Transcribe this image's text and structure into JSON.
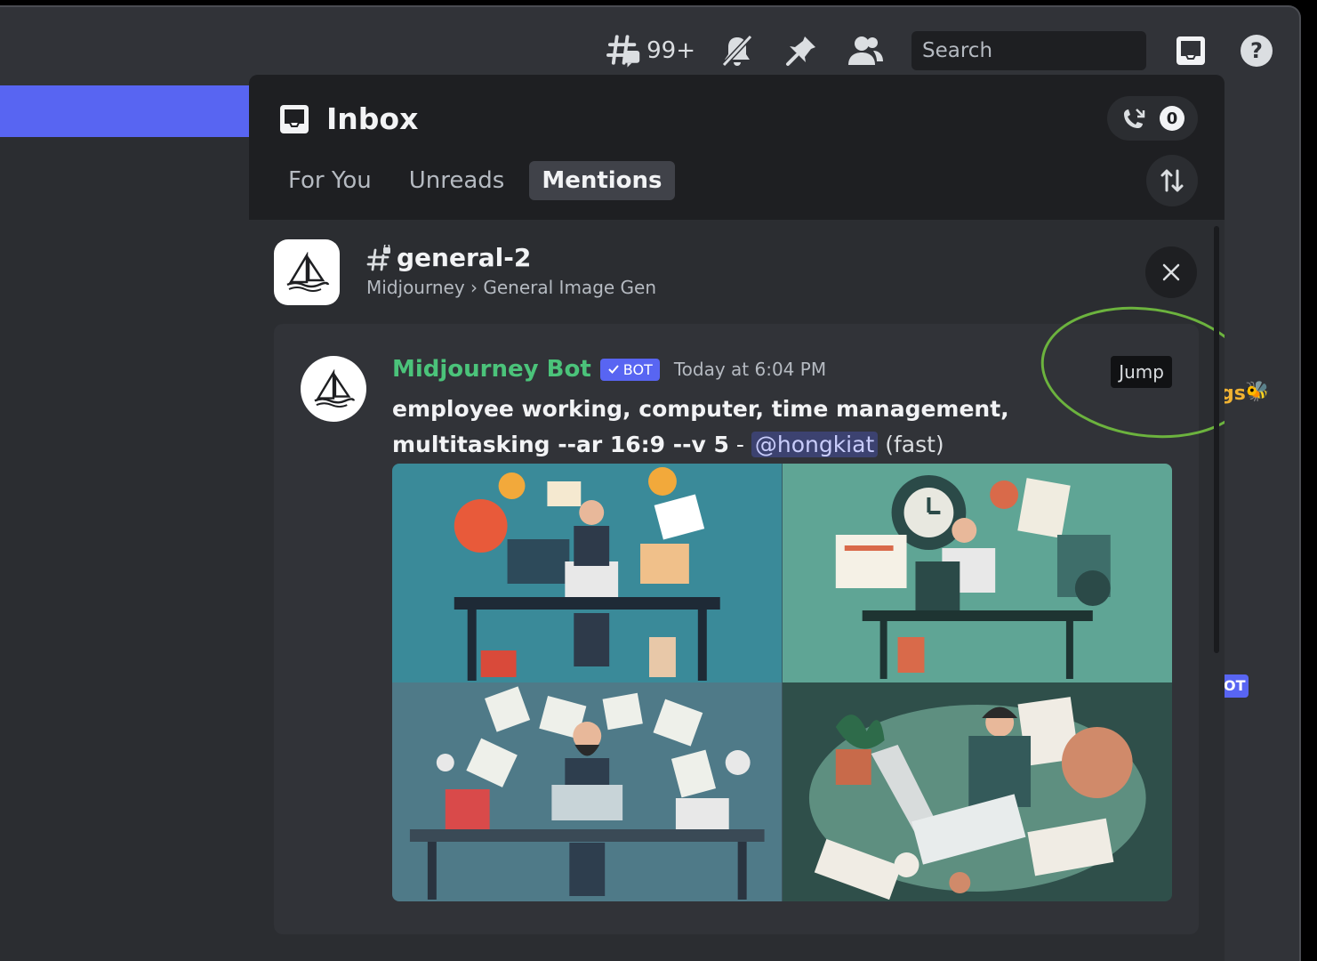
{
  "toolbar": {
    "threads_count": "99+",
    "search_placeholder": "Search"
  },
  "inbox": {
    "title": "Inbox",
    "call_count": "0",
    "tabs": [
      {
        "label": "For You",
        "active": false
      },
      {
        "label": "Unreads",
        "active": false
      },
      {
        "label": "Mentions",
        "active": true
      }
    ],
    "channel": {
      "name": "general-2",
      "path": "Midjourney › General Image Gen"
    },
    "message": {
      "author": "Midjourney Bot",
      "bot_tag": "BOT",
      "timestamp": "Today at 6:04 PM",
      "jump_label": "Jump",
      "prompt": "employee working, computer, time management, multitasking --ar 16:9 --v 5",
      "separator": " - ",
      "mention": "@hongkiat",
      "speed": "(fast)"
    }
  },
  "background_peek": {
    "text": "gs",
    "badge": "OT"
  },
  "colors": {
    "accent": "#5865f2",
    "author_green": "#4bc37a",
    "highlight_ring": "#6cb33e"
  }
}
